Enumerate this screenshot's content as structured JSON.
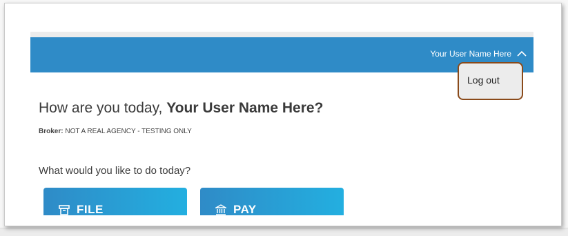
{
  "header": {
    "user_name": "Your User Name Here",
    "colors": {
      "bar": "#2f8bc7",
      "gradient_end": "#23afe0"
    }
  },
  "dropdown": {
    "logout_label": "Log out"
  },
  "main": {
    "greeting_prefix": "How are you today, ",
    "greeting_name": "Your User Name Here?",
    "broker_label": "Broker:",
    "broker_value": " NOT A REAL AGENCY - TESTING ONLY",
    "question": "What would you like to do today?"
  },
  "actions": [
    {
      "label": "FILE",
      "icon": "file-icon"
    },
    {
      "label": "PAY",
      "icon": "bank-icon"
    }
  ]
}
